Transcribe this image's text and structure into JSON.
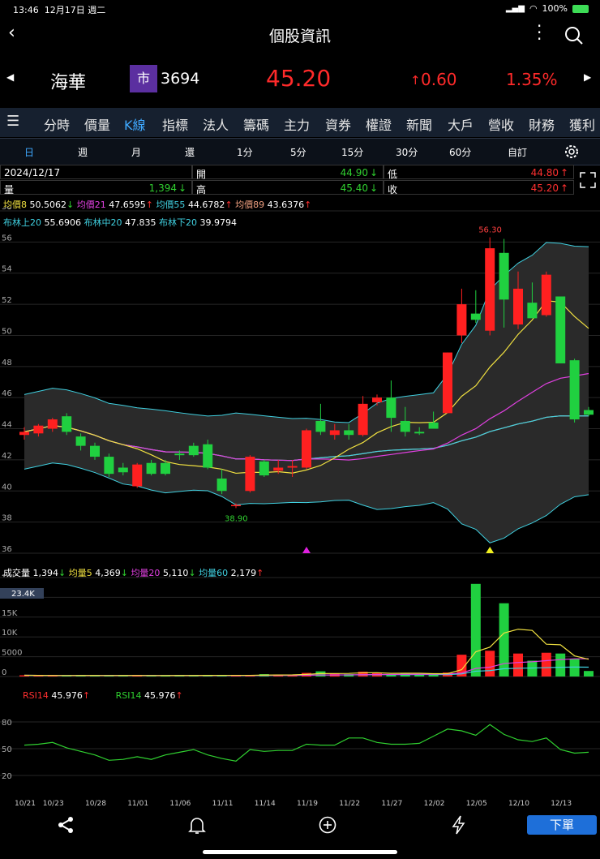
{
  "status": {
    "time": "13:46",
    "date": "12月17日 週二",
    "battery": "100%"
  },
  "nav": {
    "title": "個股資訊"
  },
  "stock": {
    "name": "海華",
    "market_badge": "市",
    "code": "3694",
    "price": "45.20",
    "change": "0.60",
    "change_pct": "1.35%"
  },
  "tabs": [
    "分時",
    "價量",
    "K線",
    "指標",
    "法人",
    "籌碼",
    "主力",
    "資券",
    "權證",
    "新聞",
    "大戶",
    "營收",
    "財務",
    "獲利"
  ],
  "active_tab": 2,
  "periods": [
    "日",
    "週",
    "月",
    "還",
    "1分",
    "5分",
    "15分",
    "30分",
    "60分",
    "自訂"
  ],
  "active_period": 0,
  "info": {
    "date": "2024/12/17",
    "open_label": "開",
    "open": "44.90",
    "low_label": "低",
    "low": "44.80",
    "vol_label": "量",
    "vol": "1,394",
    "high_label": "高",
    "high": "45.40",
    "close_label": "收",
    "close": "45.20"
  },
  "ma": [
    {
      "label": "均價8",
      "value": "50.5062",
      "dir": "↓",
      "color": "#f0e040"
    },
    {
      "label": "均價21",
      "value": "47.6595",
      "dir": "↑",
      "color": "#e040e0"
    },
    {
      "label": "均價55",
      "value": "44.6782",
      "dir": "↑",
      "color": "#40d0e0"
    },
    {
      "label": "均價89",
      "value": "43.6376",
      "dir": "↑",
      "color": "#f0a080"
    }
  ],
  "boll": [
    {
      "label": "布林上20",
      "value": "55.6906"
    },
    {
      "label": "布林中20",
      "value": "47.835"
    },
    {
      "label": "布林下20",
      "value": "39.9794"
    }
  ],
  "vol_legend": [
    {
      "label": "成交量",
      "value": "1,394",
      "dir": "↓",
      "color": "#ffffff"
    },
    {
      "label": "均量5",
      "value": "4,369",
      "dir": "↓",
      "color": "#f0e040"
    },
    {
      "label": "均量20",
      "value": "5,110",
      "dir": "↓",
      "color": "#e040e0"
    },
    {
      "label": "均量60",
      "value": "2,179",
      "dir": "↑",
      "color": "#40d0e0"
    }
  ],
  "rsi_legend": [
    {
      "label": "RSI14",
      "value": "45.976",
      "dir": "↑",
      "color": "#ff3030"
    },
    {
      "label": "RSI14",
      "value": "45.976",
      "dir": "↑",
      "color": "#30d030"
    }
  ],
  "bottom": {
    "sell": "下單"
  },
  "chart_data": [
    {
      "type": "candlestick",
      "y_ticks": [
        36,
        38,
        40,
        42,
        44,
        46,
        48,
        50,
        52,
        54,
        56,
        58
      ],
      "ylim": [
        36,
        58
      ],
      "x_labels": [
        "10/21",
        "10/23",
        "10/28",
        "11/01",
        "11/06",
        "11/11",
        "11/14",
        "11/19",
        "11/22",
        "11/27",
        "12/02",
        "12/05",
        "12/10",
        "12/13"
      ],
      "annotations": {
        "high": "56.30",
        "low": "38.90"
      },
      "candles": [
        [
          43.6,
          44.1,
          43.3,
          43.8
        ],
        [
          43.7,
          44.3,
          43.5,
          44.2
        ],
        [
          44.0,
          44.7,
          43.8,
          44.6
        ],
        [
          44.8,
          45.0,
          43.6,
          43.8
        ],
        [
          43.5,
          43.7,
          42.6,
          42.9
        ],
        [
          42.9,
          43.1,
          42.0,
          42.2
        ],
        [
          42.2,
          42.4,
          40.9,
          41.1
        ],
        [
          41.5,
          41.8,
          41.0,
          41.2
        ],
        [
          40.3,
          41.8,
          40.2,
          41.7
        ],
        [
          41.8,
          42.0,
          41.0,
          41.1
        ],
        [
          41.8,
          42.0,
          41.0,
          41.1
        ],
        [
          42.4,
          42.6,
          42.0,
          42.3
        ],
        [
          42.9,
          43.1,
          42.2,
          42.3
        ],
        [
          43.0,
          43.3,
          41.4,
          41.5
        ],
        [
          40.8,
          41.4,
          39.8,
          40.0
        ],
        [
          39.1,
          39.2,
          38.9,
          39.1
        ],
        [
          40.0,
          42.3,
          39.9,
          42.2
        ],
        [
          41.9,
          42.0,
          40.9,
          41.0
        ],
        [
          41.3,
          42.0,
          41.1,
          41.5
        ],
        [
          41.5,
          42.0,
          40.9,
          41.6
        ],
        [
          41.5,
          44.0,
          41.4,
          43.9
        ],
        [
          44.5,
          45.6,
          43.6,
          43.8
        ],
        [
          43.6,
          44.3,
          43.3,
          43.9
        ],
        [
          43.9,
          44.3,
          43.3,
          43.6
        ],
        [
          43.6,
          46.1,
          43.5,
          45.6
        ],
        [
          45.7,
          46.2,
          45.5,
          46.0
        ],
        [
          46.0,
          47.1,
          43.8,
          44.7
        ],
        [
          44.5,
          45.4,
          43.5,
          43.8
        ],
        [
          43.8,
          44.1,
          43.6,
          43.7
        ],
        [
          44.4,
          45.1,
          44.1,
          44.0
        ],
        [
          45.0,
          48.9,
          45.0,
          48.9
        ],
        [
          50.0,
          53.0,
          49.5,
          52.0
        ],
        [
          51.4,
          52.9,
          50.8,
          51.0
        ],
        [
          50.3,
          56.3,
          50.0,
          55.6
        ],
        [
          55.3,
          56.2,
          50.5,
          52.3
        ],
        [
          50.7,
          54.1,
          50.4,
          53.0
        ],
        [
          52.1,
          53.4,
          51.2,
          51.1
        ],
        [
          51.3,
          54.1,
          51.2,
          53.9
        ],
        [
          52.5,
          52.5,
          48.2,
          48.2
        ],
        [
          48.4,
          48.5,
          44.4,
          44.6
        ],
        [
          45.2,
          45.4,
          44.8,
          44.9
        ]
      ]
    },
    {
      "type": "bar",
      "y_ticks": [
        "0",
        "5000",
        "10K",
        "15K",
        "20K",
        "25K"
      ],
      "ylim": [
        0,
        25000
      ],
      "max_label": "23.4K",
      "values": [
        300,
        250,
        200,
        220,
        300,
        280,
        200,
        250,
        260,
        240,
        230,
        300,
        280,
        350,
        300,
        250,
        300,
        600,
        500,
        400,
        900,
        1300,
        700,
        600,
        1200,
        1000,
        500,
        800,
        600,
        700,
        1000,
        5500,
        23400,
        6500,
        18500,
        5800,
        4000,
        6000,
        5800,
        4500,
        1394
      ]
    },
    {
      "type": "line",
      "y_ticks": [
        20,
        50,
        80
      ],
      "ylim": [
        0,
        100
      ],
      "values": [
        54,
        55,
        57,
        51,
        47,
        43,
        37,
        38,
        41,
        38,
        43,
        46,
        49,
        43,
        39,
        36,
        49,
        47,
        48,
        48,
        55,
        54,
        54,
        62,
        62,
        57,
        55,
        55,
        56,
        64,
        72,
        70,
        65,
        77,
        66,
        60,
        58,
        62,
        49,
        45,
        46
      ]
    }
  ]
}
